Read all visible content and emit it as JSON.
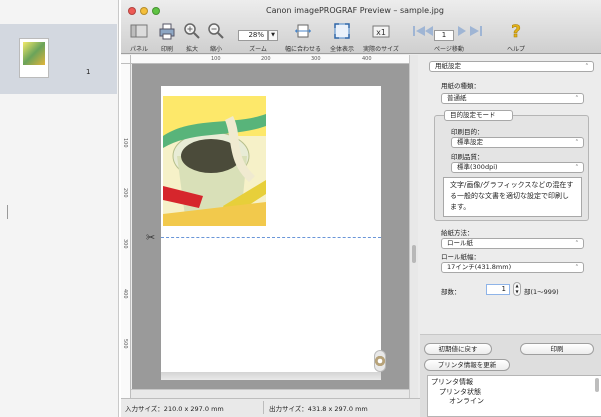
{
  "thumbnails": [
    {
      "page_number": "1"
    }
  ],
  "window": {
    "title": "Canon imagePROGRAF Preview – sample.jpg"
  },
  "toolbar": {
    "panel": "パネル",
    "print": "印刷",
    "zoom_in": "拡大",
    "zoom_out": "縮小",
    "zoom_label": "ズーム",
    "zoom_value": "28%",
    "fit_width": "幅に合わせる",
    "fit_all": "全体表示",
    "actual_size": "実際のサイズ",
    "page_move": "ページ移動",
    "page_value": "1",
    "help": "ヘルプ"
  },
  "ruler": {
    "h_ticks": [
      "100",
      "200",
      "300",
      "400"
    ],
    "v_ticks": [
      "100",
      "200",
      "300",
      "400",
      "500"
    ]
  },
  "settings": {
    "section_select": "用紙設定",
    "paper_type_label": "用紙の種類：",
    "paper_type_value": "普通紙",
    "mode_group_title": "目的設定モード",
    "purpose_label": "印刷目的：",
    "purpose_value": "標準設定",
    "quality_label": "印刷品質：",
    "quality_value": "標準(300dpi)",
    "description": "文字/画像/グラフィックスなどの混在する一般的な文書を適切な設定で印刷します。",
    "feed_label": "給紙方法：",
    "feed_value": "ロール紙",
    "roll_width_label": "ロール紙幅：",
    "roll_width_value": "17インチ(431.8mm)",
    "copies_label": "部数：",
    "copies_value": "1",
    "copies_range": "部(1〜999)"
  },
  "buttons": {
    "reset": "初期値に戻す",
    "print": "印刷",
    "update_printer": "プリンタ情報を更新"
  },
  "printer_info": [
    "プリンタ情報",
    "プリンタ状態",
    "オンライン"
  ],
  "statusbar": {
    "input_size": "入力サイズ：210.0 x 297.0 mm",
    "output_size": "出力サイズ：431.8 x 297.0 mm"
  },
  "colors": {
    "close": "#ee5a55",
    "minimize": "#f4be3a",
    "maximize": "#5fc443",
    "cut_line": "#6a96d8",
    "selection": "#d3d8e0"
  },
  "icons": {
    "panel": "panel-icon",
    "print": "printer-icon",
    "zoom_in": "zoom-in-icon",
    "zoom_out": "zoom-out-icon",
    "fit_width": "fit-width-icon",
    "fit_all": "fit-all-icon",
    "actual_size": "actual-size-icon",
    "help": "help-icon",
    "scissors": "scissors-icon"
  }
}
